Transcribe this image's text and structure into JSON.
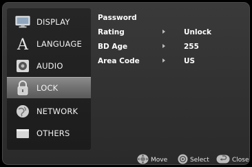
{
  "sidebar": {
    "items": [
      {
        "label": "DISPLAY",
        "icon": "display-icon"
      },
      {
        "label": "LANGUAGE",
        "icon": "language-icon"
      },
      {
        "label": "AUDIO",
        "icon": "audio-icon"
      },
      {
        "label": "LOCK",
        "icon": "lock-icon",
        "selected": true
      },
      {
        "label": "NETWORK",
        "icon": "network-icon"
      },
      {
        "label": "OTHERS",
        "icon": "others-icon"
      }
    ]
  },
  "settings": {
    "rows": [
      {
        "label": "Password",
        "value": ""
      },
      {
        "label": "Rating",
        "value": "Unlock"
      },
      {
        "label": "BD Age",
        "value": "255"
      },
      {
        "label": "Area Code",
        "value": "US"
      }
    ]
  },
  "footer": {
    "move_label": "Move",
    "select_label": "Select",
    "close_label": "Close"
  },
  "colors": {
    "selected_bg": "#7a7a7a",
    "panel_bg": "#2e2e2e",
    "sidebar_bg": "#1f1f1f"
  }
}
